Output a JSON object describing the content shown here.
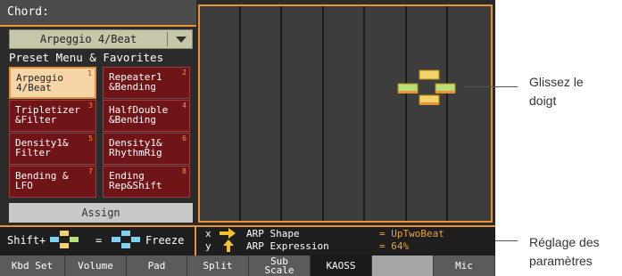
{
  "header": {
    "title": "Chord:"
  },
  "dropdown": {
    "value": "Arpeggio 4/Beat"
  },
  "preset_section_label": "Preset Menu & Favorites",
  "presets": [
    {
      "num": "1",
      "label": "Arpeggio\n4/Beat",
      "selected": true
    },
    {
      "num": "2",
      "label": "Repeater1\n&Bending"
    },
    {
      "num": "3",
      "label": "Tripletizer\n&Filter"
    },
    {
      "num": "4",
      "label": "HalfDouble\n&Bending"
    },
    {
      "num": "5",
      "label": "Density1&\nFilter"
    },
    {
      "num": "6",
      "label": "Density1&\nRhythmRig"
    },
    {
      "num": "7",
      "label": "Bending &\nLFO"
    },
    {
      "num": "8",
      "label": "Ending\nRep&Shift"
    }
  ],
  "assign_label": "Assign",
  "shift": {
    "shift_label": "Shift+",
    "equals": "=",
    "freeze_label": "Freeze"
  },
  "params": {
    "x_label": "x",
    "y_label": "y",
    "x_name": "ARP Shape",
    "y_name": "ARP Expression",
    "x_value": "= UpTwoBeat",
    "y_value": "= 64%"
  },
  "tabs": [
    "Kbd Set",
    "Volume",
    "Pad",
    "Split",
    "Sub\nScale",
    "KAOSS",
    "",
    "Mic"
  ],
  "selected_tab": "KAOSS",
  "callouts": {
    "top": "Glissez le\ndoigt",
    "bottom": "Réglage des\nparamètres"
  },
  "colors": {
    "accent": "#e8923a",
    "preset_bg": "#6f1417",
    "selected_preset_bg": "#f6d5a6",
    "value_text": "#e8a33a"
  },
  "icons": [
    "chevron-down-icon",
    "right-arrow-icon",
    "up-arrow-icon",
    "finger-drag-icon",
    "freeze-icon",
    "touch-point-icon"
  ]
}
